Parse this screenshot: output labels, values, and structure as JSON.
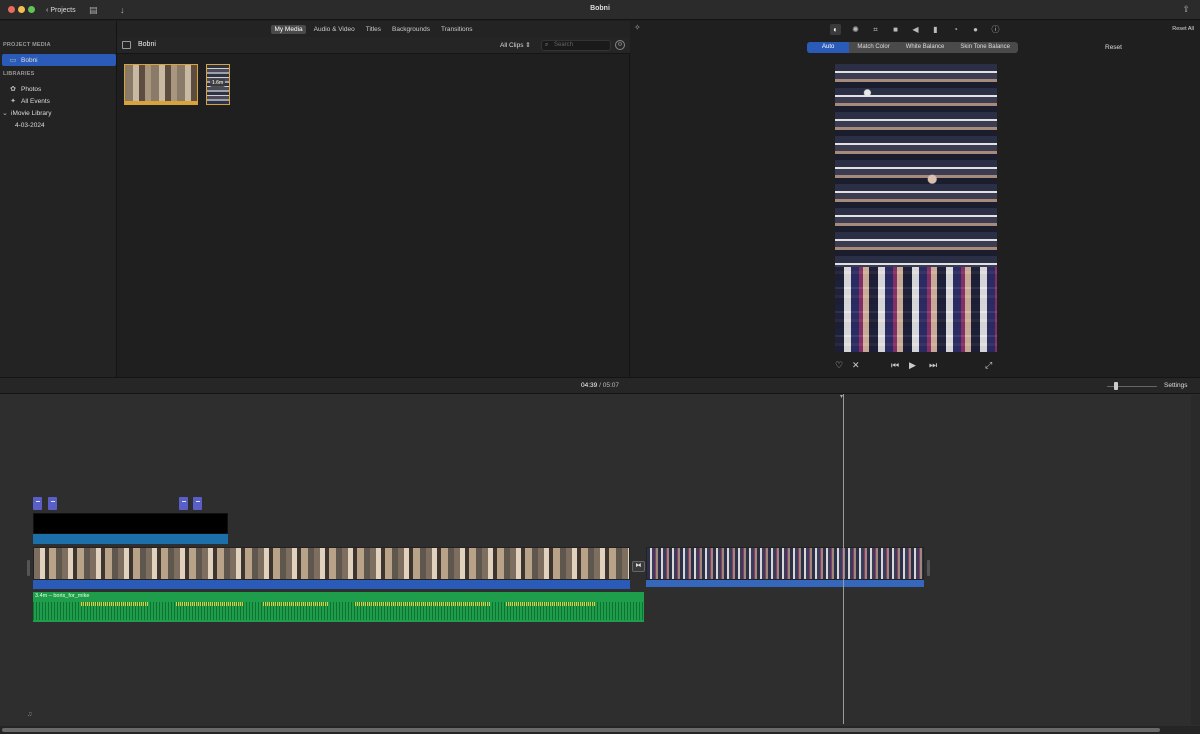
{
  "window": {
    "title": "Bobni",
    "projects_label": "Projects"
  },
  "sidebar": {
    "project_media_heading": "PROJECT MEDIA",
    "project_item": "Bobni",
    "libraries_heading": "LIBRARIES",
    "photos": "Photos",
    "all_events": "All Events",
    "library_name": "iMovie Library",
    "event_date": "4-03-2024"
  },
  "browser": {
    "tabs": [
      "My Media",
      "Audio & Video",
      "Titles",
      "Backgrounds",
      "Transitions"
    ],
    "active_tab": "My Media",
    "title": "Bobni",
    "clips_filter": "All Clips",
    "search_placeholder": "Search",
    "thumb2_duration": "1.6m"
  },
  "viewer": {
    "reset_all": "Reset All",
    "adjust_buttons": [
      "Auto",
      "Match Color",
      "White Balance",
      "Skin Tone Balance"
    ],
    "active_adjust": "Auto",
    "reset": "Reset"
  },
  "timeline": {
    "current_time": "04:39",
    "separator": "/",
    "total_time": "05:07",
    "settings": "Settings",
    "audio_label": "3.4m – boris_for_mike"
  },
  "colors": {
    "accent": "#2a5bb8",
    "audio": "#1e9e4a",
    "marker": "#5a5fc8",
    "title_strip": "#1c6fa8"
  }
}
